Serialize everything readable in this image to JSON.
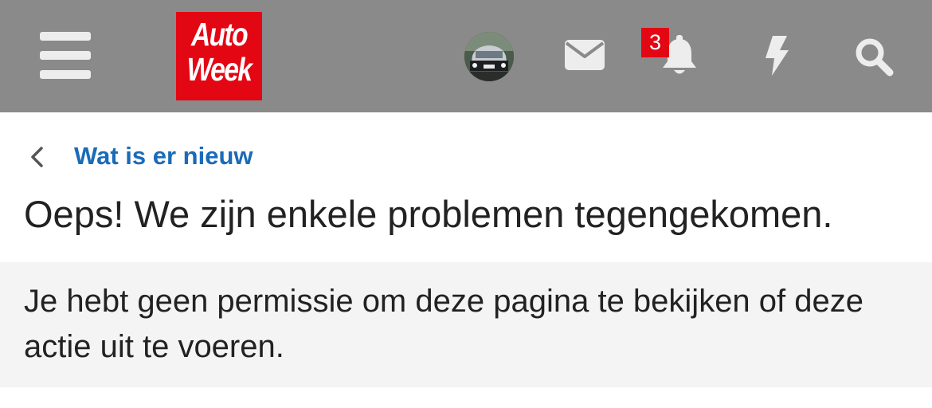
{
  "header": {
    "logo_line1": "Auto",
    "logo_line2": "Week",
    "notification_count": "3",
    "icons": [
      "hamburger-menu-icon",
      "envelope-icon",
      "bell-icon",
      "bolt-icon",
      "search-icon"
    ],
    "colors": {
      "bar": "#8a8a8a",
      "icon": "#ededed",
      "brand": "#e30613"
    }
  },
  "breadcrumb": {
    "label": "Wat is er nieuw",
    "color": "#1a6bb8"
  },
  "page": {
    "title": "Oeps! We zijn enkele problemen tegengekomen.",
    "message": "Je hebt geen permissie om deze pagina te bekijken of deze actie uit te voeren."
  }
}
